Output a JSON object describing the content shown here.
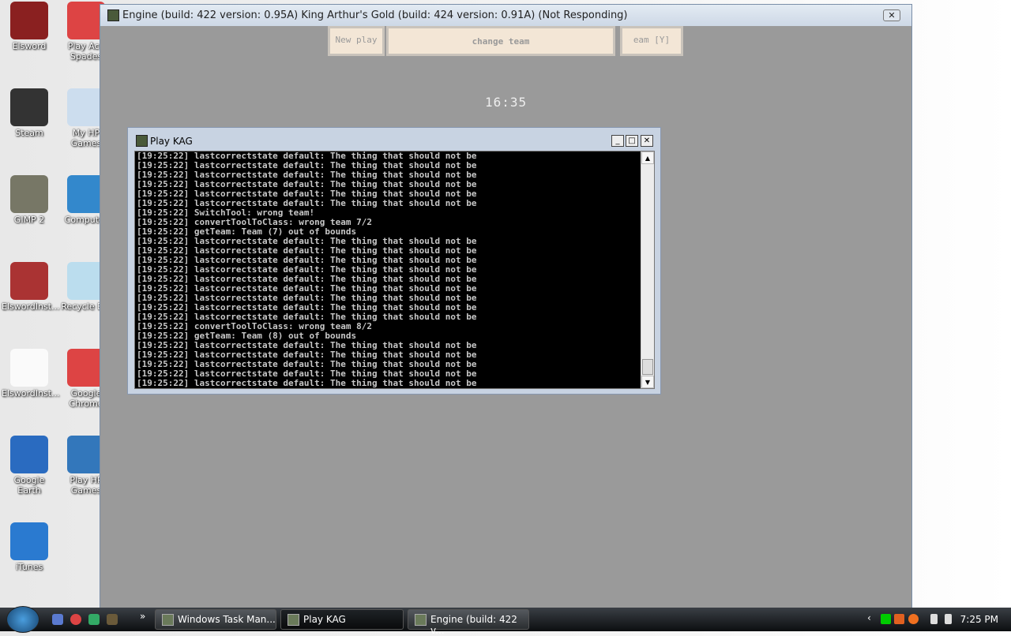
{
  "desktop": {
    "icons": [
      {
        "label": "Elsword",
        "color": "#8a2020"
      },
      {
        "label": "Play Ace Spades",
        "color": "#d44"
      },
      {
        "label": "Steam",
        "color": "#333"
      },
      {
        "label": "My HP Games",
        "color": "#cde"
      },
      {
        "label": "GIMP 2",
        "color": "#776"
      },
      {
        "label": "Computer",
        "color": "#38c"
      },
      {
        "label": "ElswordInst...",
        "color": "#a33"
      },
      {
        "label": "Recycle Bin",
        "color": "#bde"
      },
      {
        "label": "ElswordInst...",
        "color": "#fafafa"
      },
      {
        "label": "Google Chrome",
        "color": "#d44"
      },
      {
        "label": "Google Earth",
        "color": "#2a6bc0"
      },
      {
        "label": "Play HP Games",
        "color": "#37b"
      },
      {
        "label": "iTunes",
        "color": "#2a7ad0"
      }
    ]
  },
  "game_window": {
    "title": "Engine (build: 422 version: 0.95A) King Arthur's Gold (build: 424 version: 0.91A) (Not Responding)",
    "banners": [
      "New play",
      "change team",
      "eam [Y]"
    ],
    "timer": "16:35"
  },
  "kag_window": {
    "title": "Play KAG",
    "lines": [
      "[19:25:22] lastcorrectstate default: The thing that should not be",
      "[19:25:22] lastcorrectstate default: The thing that should not be",
      "[19:25:22] lastcorrectstate default: The thing that should not be",
      "[19:25:22] lastcorrectstate default: The thing that should not be",
      "[19:25:22] lastcorrectstate default: The thing that should not be",
      "[19:25:22] lastcorrectstate default: The thing that should not be",
      "[19:25:22] SwitchTool: wrong team!",
      "[19:25:22] convertToolToClass: wrong team 7/2",
      "[19:25:22] getTeam: Team (7) out of bounds",
      "[19:25:22] lastcorrectstate default: The thing that should not be",
      "[19:25:22] lastcorrectstate default: The thing that should not be",
      "[19:25:22] lastcorrectstate default: The thing that should not be",
      "[19:25:22] lastcorrectstate default: The thing that should not be",
      "[19:25:22] lastcorrectstate default: The thing that should not be",
      "[19:25:22] lastcorrectstate default: The thing that should not be",
      "[19:25:22] lastcorrectstate default: The thing that should not be",
      "[19:25:22] lastcorrectstate default: The thing that should not be",
      "[19:25:22] lastcorrectstate default: The thing that should not be",
      "[19:25:22] convertToolToClass: wrong team 8/2",
      "[19:25:22] getTeam: Team (8) out of bounds",
      "[19:25:22] lastcorrectstate default: The thing that should not be",
      "[19:25:22] lastcorrectstate default: The thing that should not be",
      "[19:25:22] lastcorrectstate default: The thing that should not be",
      "[19:25:22] lastcorrectstate default: The thing that should not be",
      "[19:25:22] lastcorrectstate default: The thing that should not be"
    ]
  },
  "taskbar": {
    "overflow": "»",
    "buttons": [
      "Windows Task Man...",
      "Play KAG",
      "Engine (build: 422 v..."
    ],
    "clock": "7:25 PM"
  }
}
